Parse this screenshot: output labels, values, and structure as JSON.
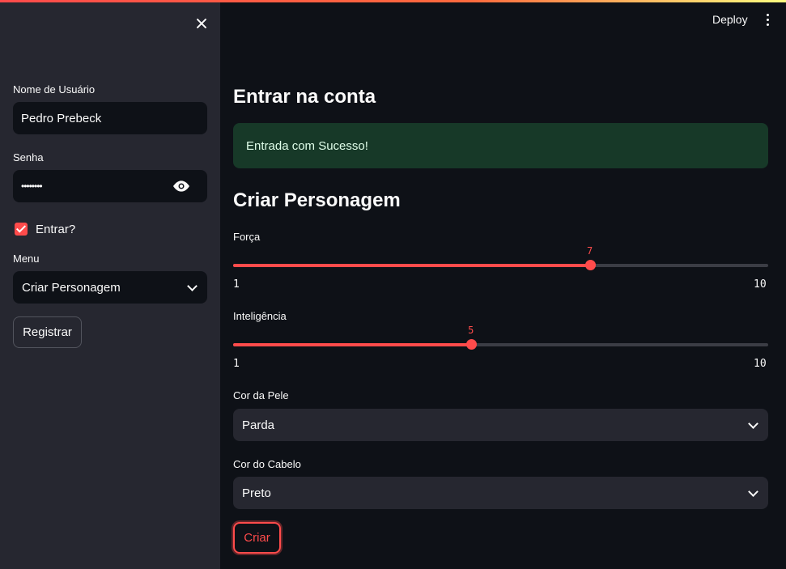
{
  "header": {
    "deploy_label": "Deploy",
    "menu_icon": "kebab-menu-icon"
  },
  "sidebar": {
    "close_icon": "close-icon",
    "username": {
      "label": "Nome de Usuário",
      "value": "Pedro Prebeck"
    },
    "password": {
      "label": "Senha",
      "value": "••••••••",
      "toggle_icon": "eye-icon"
    },
    "checkbox": {
      "label": "Entrar?",
      "checked": true
    },
    "menu": {
      "label": "Menu",
      "selected": "Criar Personagem"
    },
    "register_label": "Registrar"
  },
  "main": {
    "login_title": "Entrar na conta",
    "success_message": "Entrada com Sucesso!",
    "create_title": "Criar Personagem",
    "sliders": [
      {
        "label": "Força",
        "value": 7,
        "min": 1,
        "max": 10,
        "min_label": "1",
        "max_label": "10",
        "value_label": "7"
      },
      {
        "label": "Inteligência",
        "value": 5,
        "min": 1,
        "max": 10,
        "min_label": "1",
        "max_label": "10",
        "value_label": "5"
      }
    ],
    "skin": {
      "label": "Cor da Pele",
      "selected": "Parda"
    },
    "hair": {
      "label": "Cor do Cabelo",
      "selected": "Preto"
    },
    "create_label": "Criar"
  },
  "colors": {
    "accent": "#ff4b4b",
    "background": "#0e1117",
    "sidebar": "#262730",
    "success_bg": "#173928"
  }
}
